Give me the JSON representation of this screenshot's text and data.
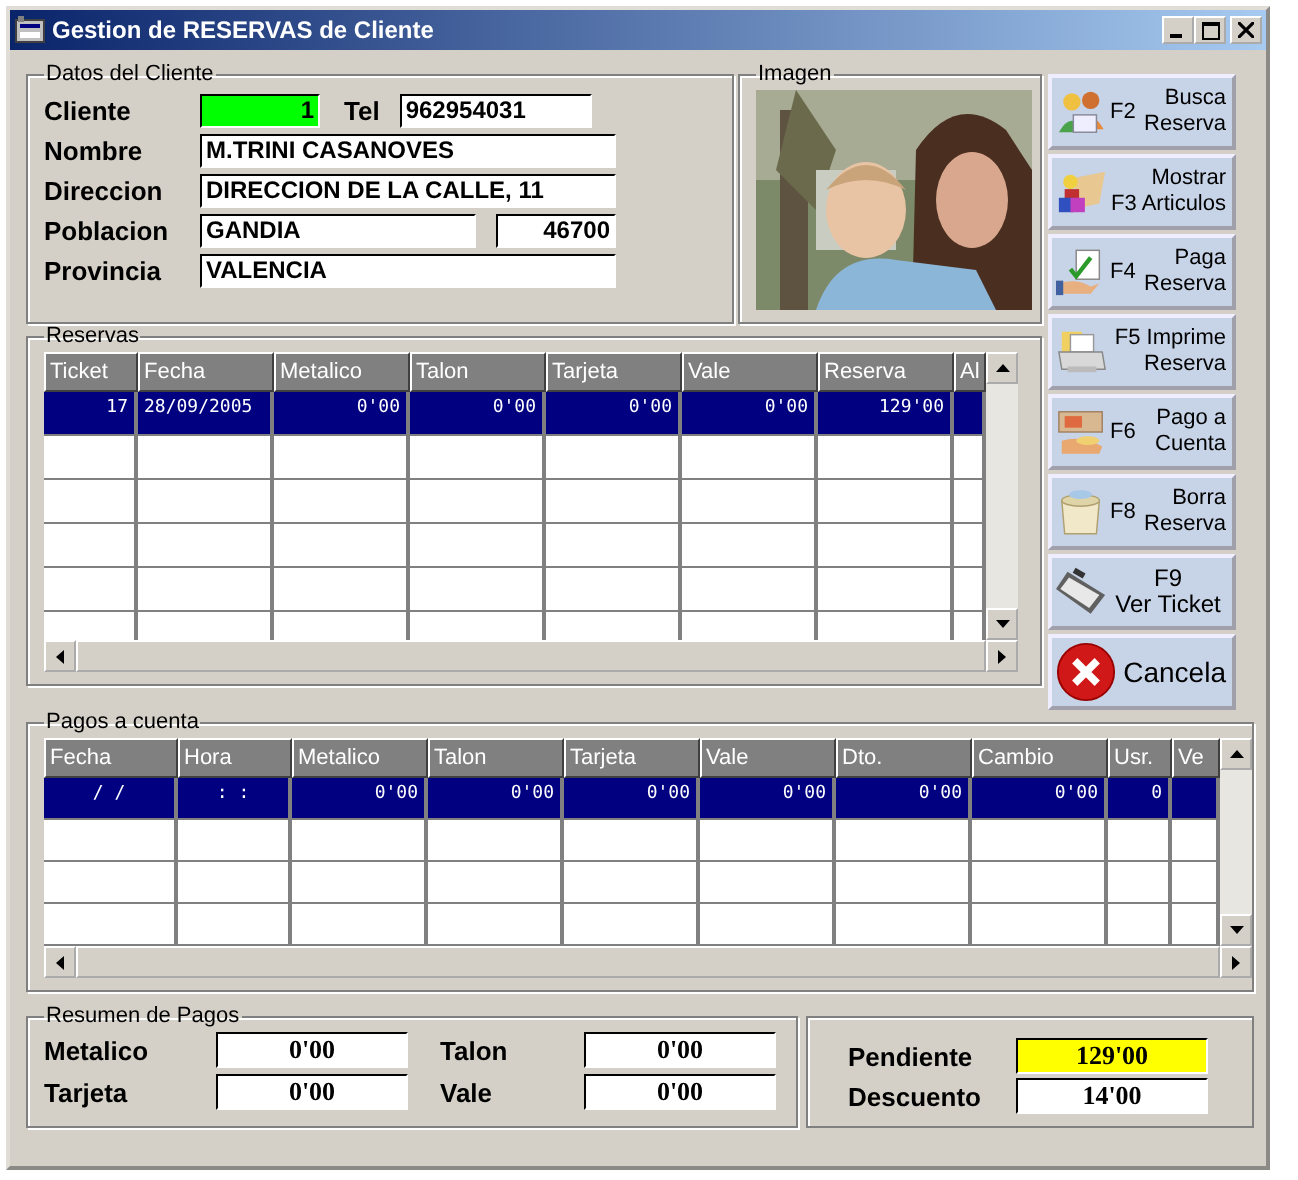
{
  "window": {
    "title": "Gestion de RESERVAS de Cliente"
  },
  "client": {
    "legend": "Datos del Cliente",
    "fields": [
      {
        "label": "Cliente",
        "value": "1"
      },
      {
        "label": "Tel",
        "value": "962954031"
      },
      {
        "label": "Nombre",
        "value": "M.TRINI CASANOVES"
      },
      {
        "label": "Direccion",
        "value": "DIRECCION DE LA CALLE, 11"
      },
      {
        "label": "Poblacion",
        "value": "GANDIA"
      },
      {
        "value": "46700"
      },
      {
        "label": "Provincia",
        "value": "VALENCIA"
      }
    ]
  },
  "image": {
    "legend": "Imagen",
    "kind": "picture"
  },
  "reservas": {
    "legend": "Reservas",
    "columns": [
      "Ticket",
      "Fecha",
      "Metalico",
      "Talon",
      "Tarjeta",
      "Vale",
      "Reserva",
      "Al"
    ],
    "rows": [
      {
        "selected": true,
        "cells": [
          "17",
          "28/09/2005",
          "0'00",
          "0'00",
          "0'00",
          "0'00",
          "129'00",
          ""
        ]
      }
    ]
  },
  "actions": [
    {
      "kind": "key-left",
      "key": "F2",
      "lines": [
        "Busca",
        "Reserva"
      ]
    },
    {
      "kind": "lines",
      "lines": [
        "Mostrar",
        "F3 Articulos"
      ]
    },
    {
      "kind": "key-left",
      "key": "F4",
      "lines": [
        "Paga",
        "Reserva"
      ]
    },
    {
      "kind": "lines",
      "lines": [
        "F5 Imprime",
        "Reserva"
      ]
    },
    {
      "kind": "key-left",
      "key": "F6",
      "lines": [
        "Pago a",
        "Cuenta"
      ]
    },
    {
      "kind": "key-left",
      "key": "F8",
      "lines": [
        "Borra",
        "Reserva"
      ]
    },
    {
      "kind": "center",
      "lines": [
        "F9",
        "Ver Ticket"
      ]
    },
    {
      "kind": "cancel",
      "lines": [
        "Cancela"
      ]
    }
  ],
  "pagos": {
    "legend": "Pagos a cuenta",
    "columns": [
      "Fecha",
      "Hora",
      "Metalico",
      "Talon",
      "Tarjeta",
      "Vale",
      "Dto.",
      "Cambio",
      "Usr.",
      "Ve"
    ],
    "rows": [
      {
        "selected": true,
        "cells": [
          "/ /",
          ": :",
          "0'00",
          "0'00",
          "0'00",
          "0'00",
          "0'00",
          "0'00",
          "0",
          ""
        ]
      }
    ]
  },
  "resumen": {
    "legend": "Resumen de Pagos",
    "totals": [
      {
        "label": "Metalico",
        "value": "0'00"
      },
      {
        "label": "Talon",
        "value": "0'00"
      },
      {
        "label": "Tarjeta",
        "value": "0'00"
      },
      {
        "label": "Vale",
        "value": "0'00"
      }
    ],
    "pendiente": {
      "label": "Pendiente",
      "value": "129'00"
    },
    "descuento": {
      "label": "Descuento",
      "value": "14'00"
    }
  }
}
